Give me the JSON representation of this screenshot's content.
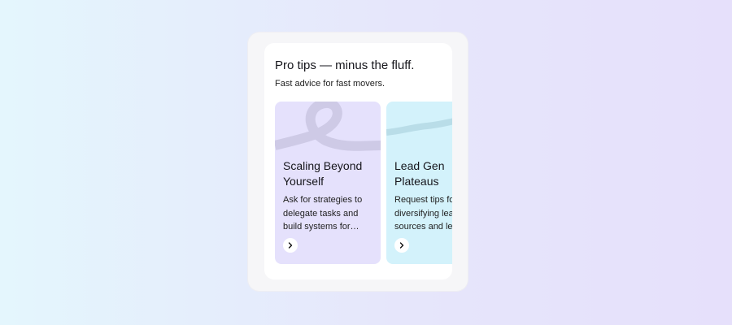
{
  "header": {
    "title": "Pro tips — minus the fluff.",
    "subtitle": "Fast advice for fast movers."
  },
  "cards": [
    {
      "title": "Scaling Beyond Yourself",
      "description": "Ask for strategies to delegate tasks and build systems for sustainable growth.",
      "background": "#e5e1fc",
      "icon": "chevron-right-icon"
    },
    {
      "title": "Lead Gen Plateaus",
      "description": "Request tips for diversifying lead sources and levels",
      "background": "#d3f2fb",
      "icon": "chevron-right-icon"
    }
  ]
}
